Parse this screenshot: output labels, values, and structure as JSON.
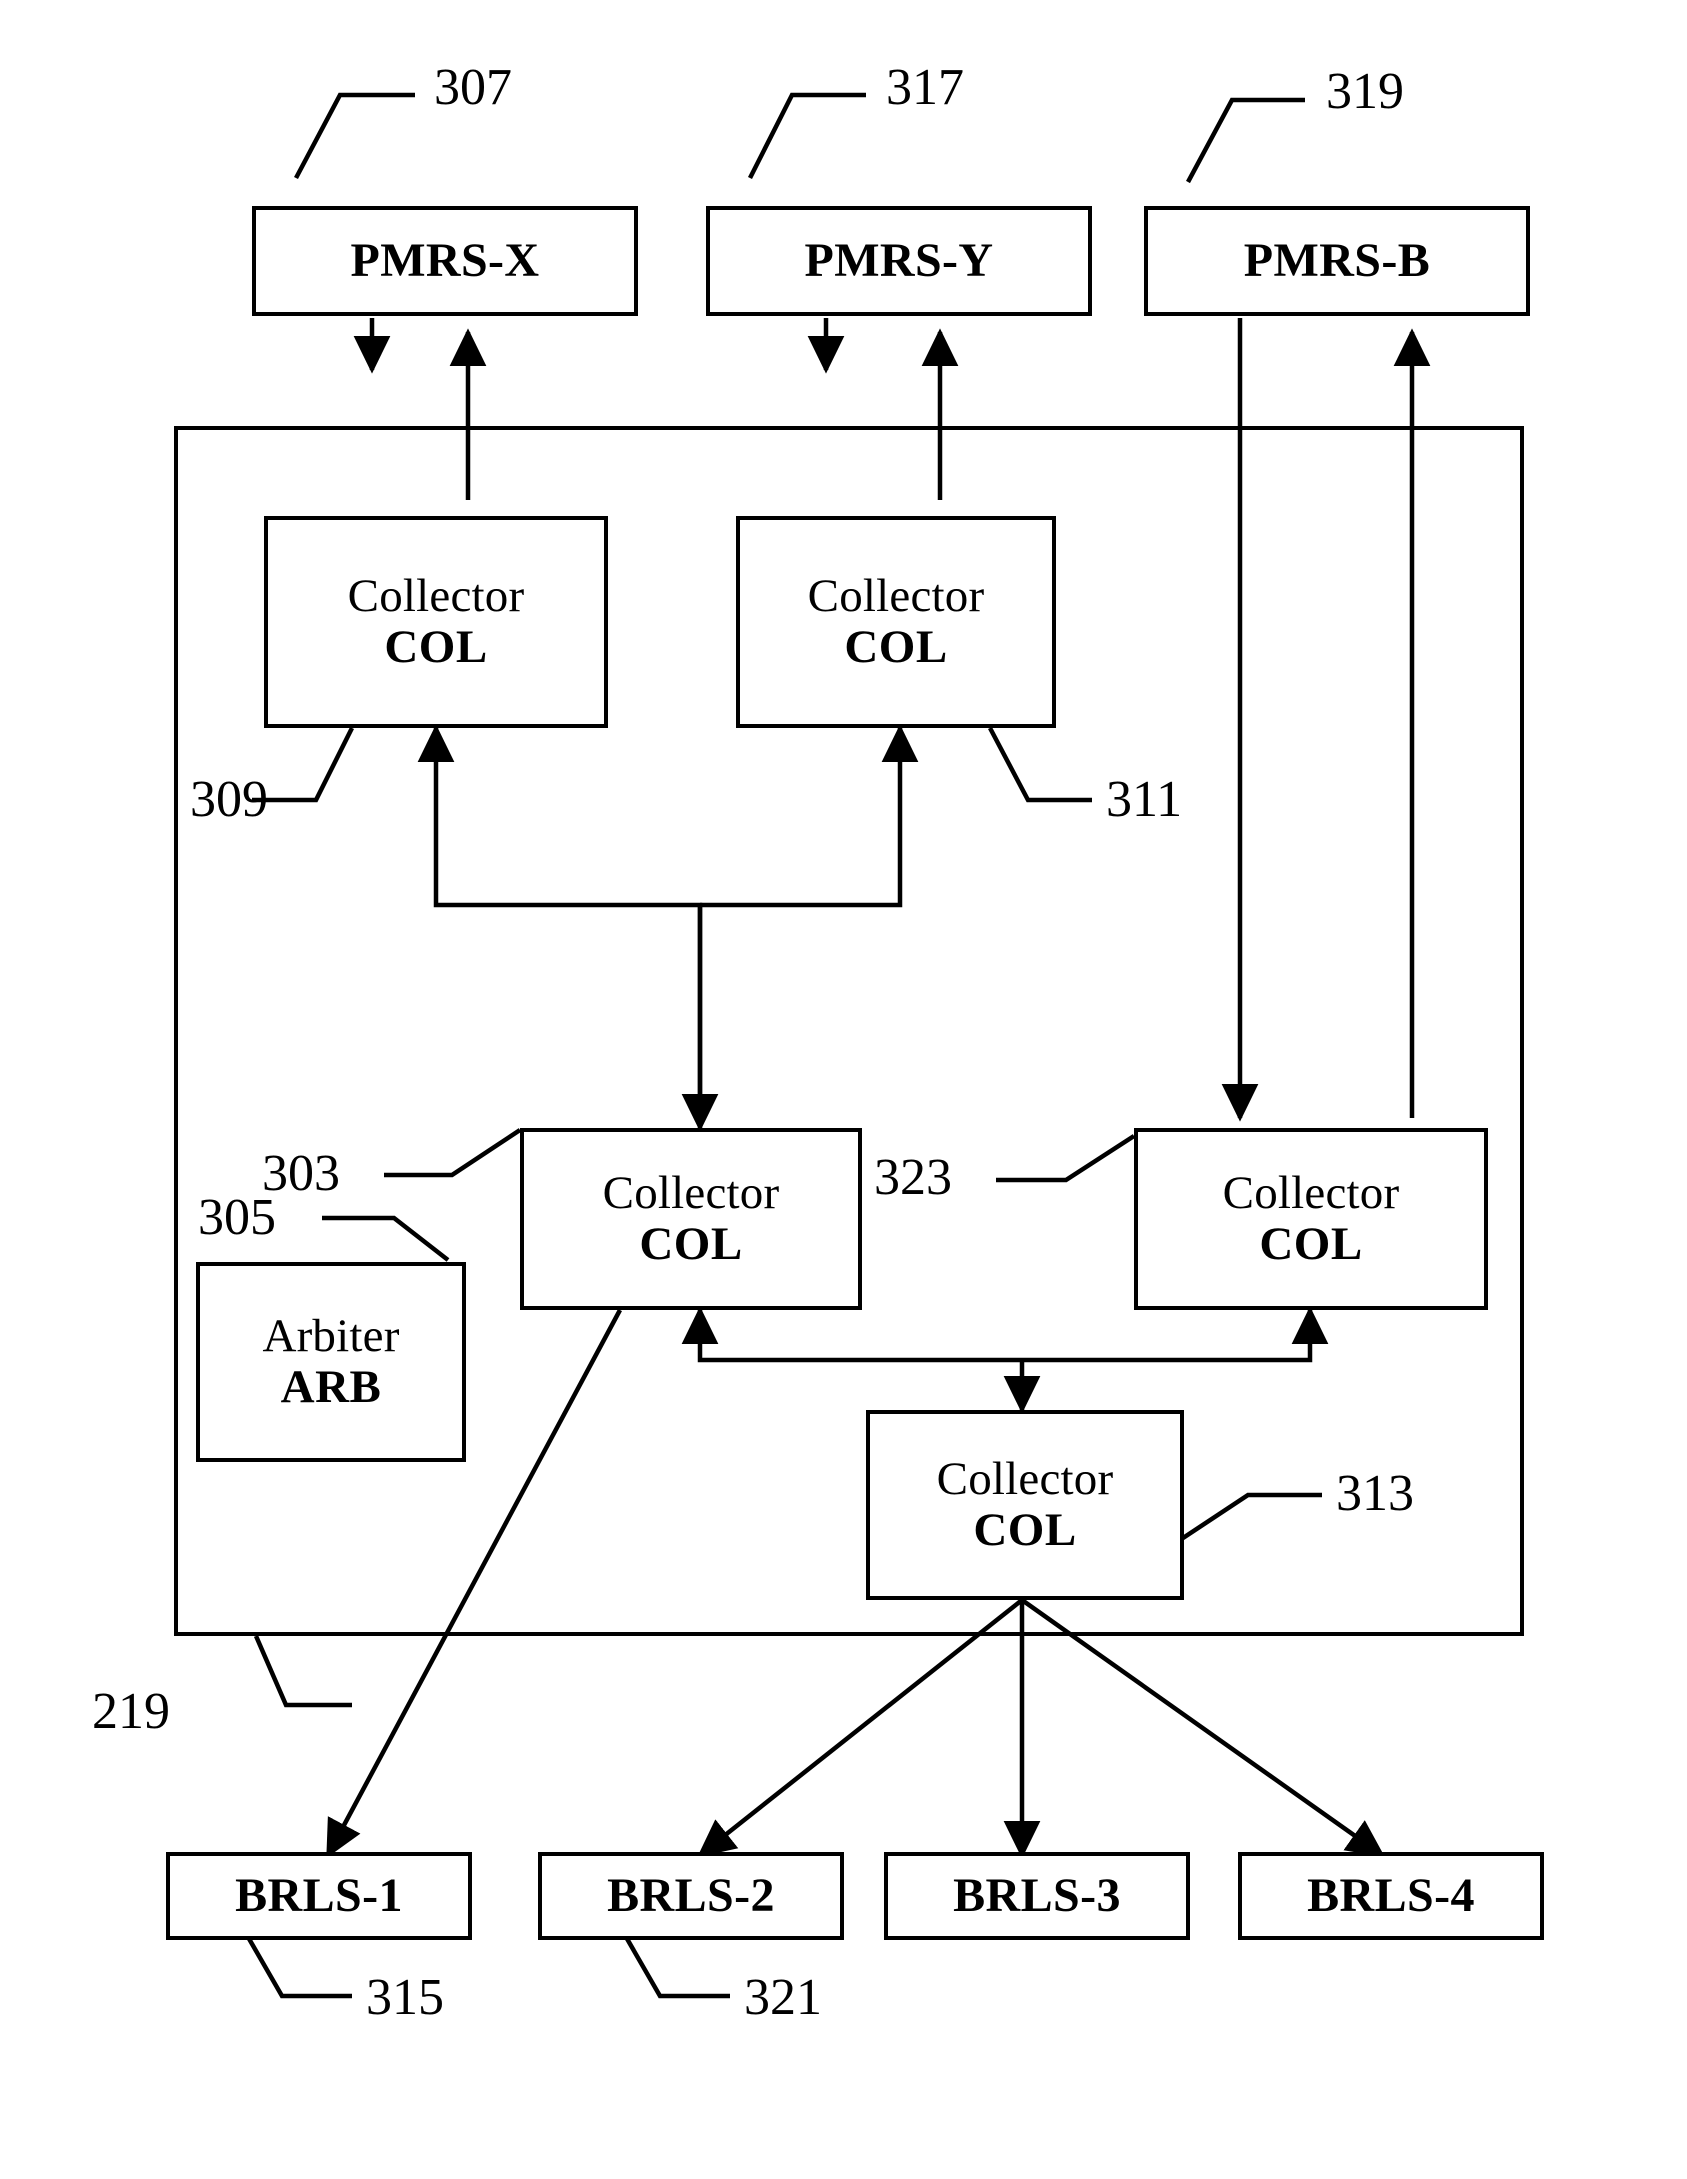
{
  "figure": {
    "type": "patent-block-diagram",
    "background_color": "#ffffff",
    "stroke_color": "#000000"
  },
  "top_modules": [
    {
      "label": "PMRS-X",
      "ref": "307"
    },
    {
      "label": "PMRS-Y",
      "ref": "317"
    },
    {
      "label": "PMRS-B",
      "ref": "319"
    }
  ],
  "collectors": [
    {
      "title": "Collector",
      "code": "COL",
      "ref": "309"
    },
    {
      "title": "Collector",
      "code": "COL",
      "ref": "311"
    },
    {
      "title": "Collector",
      "code": "COL",
      "ref": "303"
    },
    {
      "title": "Collector",
      "code": "COL",
      "ref": "323"
    },
    {
      "title": "Collector",
      "code": "COL",
      "ref": "313"
    }
  ],
  "arbiter": {
    "title": "Arbiter",
    "code": "ARB",
    "ref": "305"
  },
  "bottom_modules": [
    {
      "label": "BRLS-1",
      "ref": "315"
    },
    {
      "label": "BRLS-2",
      "ref": "321"
    },
    {
      "label": "BRLS-3",
      "ref": ""
    },
    {
      "label": "BRLS-4",
      "ref": ""
    }
  ],
  "outer_frame": {
    "ref": "219"
  },
  "reference_numerals": {
    "n307": "307",
    "n317": "317",
    "n319": "319",
    "n309": "309",
    "n311": "311",
    "n303": "303",
    "n305": "305",
    "n323": "323",
    "n313": "313",
    "n315": "315",
    "n321": "321",
    "n219": "219"
  },
  "node_text": {
    "pmrs_x": "PMRS-X",
    "pmrs_y": "PMRS-Y",
    "pmrs_b": "PMRS-B",
    "collector": "Collector",
    "col": "COL",
    "arbiter": "Arbiter",
    "arb": "ARB",
    "brls_1": "BRLS-1",
    "brls_2": "BRLS-2",
    "brls_3": "BRLS-3",
    "brls_4": "BRLS-4"
  }
}
